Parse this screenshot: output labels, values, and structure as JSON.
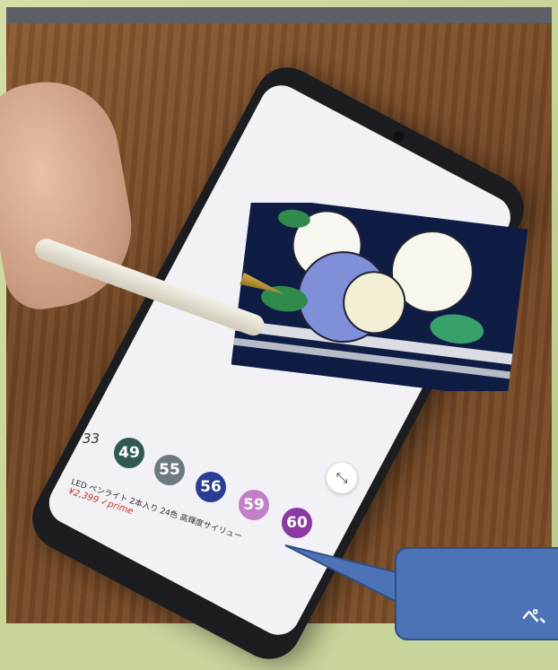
{
  "palette": {
    "numbers": [
      "33",
      "49",
      "55",
      "56",
      "59",
      "60"
    ]
  },
  "ad": {
    "title": "LED ペンライト 2本入り 24色 高輝度サイリュー",
    "price": "¥2,399",
    "badge": "✓prime"
  },
  "callout": {
    "text": "ぺ、"
  },
  "colors": {
    "swatch_49": "#2e5a52",
    "swatch_55": "#6e7a82",
    "swatch_56": "#2b3c93",
    "swatch_59": "#c07fc6",
    "swatch_60": "#8b3aa3",
    "callout": "#4b73b5"
  },
  "icons": {
    "shrink": "shrink-icon",
    "back": "back-arrow-icon"
  }
}
